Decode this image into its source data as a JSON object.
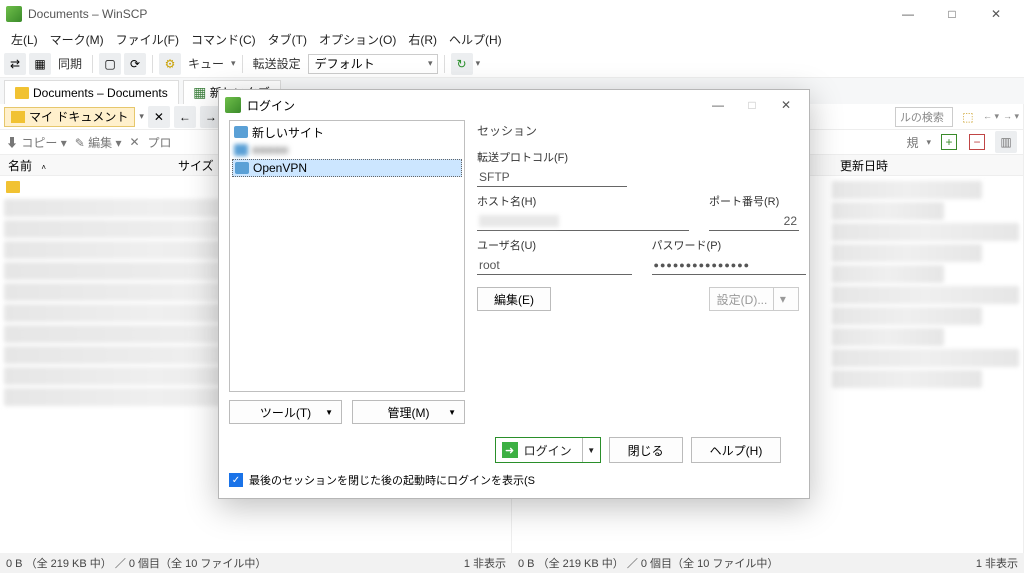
{
  "window": {
    "title": "Documents – WinSCP",
    "minimize": "—",
    "maximize": "□",
    "close": "✕"
  },
  "menu": {
    "left": "左(L)",
    "mark": "マーク(M)",
    "file": "ファイル(F)",
    "command": "コマンド(C)",
    "tab": "タブ(T)",
    "option": "オプション(O)",
    "right": "右(R)",
    "help": "ヘルプ(H)"
  },
  "toolbar": {
    "sync": "同期",
    "queue": "キュー",
    "transfer_settings": "転送設定",
    "transfer_default": "デフォルト"
  },
  "tabs": {
    "main": "Documents – Documents",
    "newtab": "新しいタブ"
  },
  "panel": {
    "crumb": "マイ ドキュメント",
    "copy": "コピー",
    "edit": "編集",
    "pro": "プロ",
    "col_name": "名前",
    "col_size": "サイズ",
    "right_newview": "規",
    "search_placeholder": "ルの検索",
    "col_update": "更新日時"
  },
  "status": {
    "left_l": "0 B （全 219 KB 中） ／ 0 個目（全 10 ファイル中）",
    "left_r": "1 非表示",
    "right_l": "0 B （全 219 KB 中） ／ 0 個目（全 10 ファイル中）",
    "right_r": "1 非表示"
  },
  "dialog": {
    "title": "ログイン",
    "sites": {
      "new": "新しいサイト",
      "hidden": "■■■■■",
      "openvpn": "OpenVPN"
    },
    "tools_btn": "ツール(T)",
    "manage_btn": "管理(M)",
    "session_grp": "セッション",
    "protocol_label": "転送プロトコル(F)",
    "protocol_value": "SFTP",
    "host_label": "ホスト名(H)",
    "port_label": "ポート番号(R)",
    "port_value": "22",
    "user_label": "ユーザ名(U)",
    "user_value": "root",
    "pass_label": "パスワード(P)",
    "edit_btn": "編集(E)",
    "settings_btn": "設定(D)...",
    "login_btn": "ログイン",
    "close_btn": "閉じる",
    "help_btn": "ヘルプ(H)",
    "checkbox_label": "最後のセッションを閉じた後の起動時にログインを表示(S"
  }
}
